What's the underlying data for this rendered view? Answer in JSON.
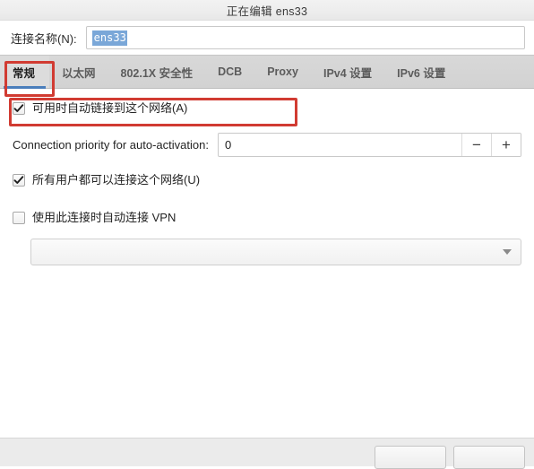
{
  "window": {
    "title": "正在编辑 ens33"
  },
  "name_row": {
    "label": "连接名称(N):",
    "value": "ens33",
    "placeholder": ""
  },
  "tabs": [
    {
      "label": "常规",
      "active": true
    },
    {
      "label": "以太网",
      "active": false
    },
    {
      "label": "802.1X 安全性",
      "active": false
    },
    {
      "label": "DCB",
      "active": false
    },
    {
      "label": "Proxy",
      "active": false
    },
    {
      "label": "IPv4 设置",
      "active": false
    },
    {
      "label": "IPv6 设置",
      "active": false
    }
  ],
  "general": {
    "autoconnect": {
      "label": "可用时自动链接到这个网络(A)",
      "checked": true
    },
    "priority": {
      "label": "Connection priority for auto-activation:",
      "value": "0",
      "minus_label": "−",
      "plus_label": "+"
    },
    "all_users": {
      "label": "所有用户都可以连接这个网络(U)",
      "checked": true
    },
    "auto_vpn": {
      "label": "使用此连接时自动连接 VPN",
      "checked": false
    },
    "vpn_combo": {
      "value": "",
      "arrow_icon": "chevron-down-icon"
    }
  },
  "footer": {
    "cancel_label": "",
    "save_label": ""
  },
  "annotations": {
    "tab_highlight_color": "#d13b32",
    "autoconnect_highlight_color": "#d13b32",
    "active_tab_underline_color": "#4a7ebb",
    "selection_color": "#7aa7d8"
  }
}
